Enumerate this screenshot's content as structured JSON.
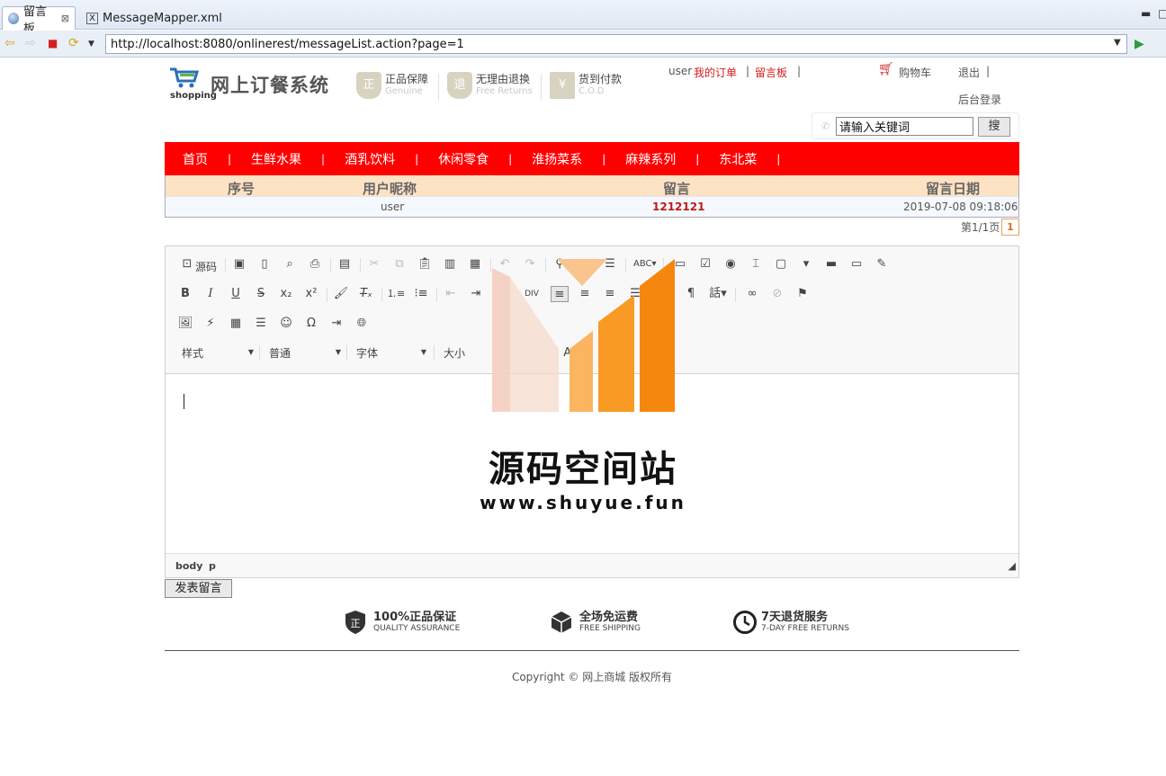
{
  "browser": {
    "tabs": [
      {
        "label": "留言板",
        "close": "⊠"
      },
      {
        "label": "MessageMapper.xml"
      }
    ],
    "url": "http://localhost:8080/onlinerest/messageList.action?page=1"
  },
  "header": {
    "logo_sub": "shopping",
    "site_title": "网上订餐系统",
    "guarantees": [
      {
        "icon": "正",
        "title": "正品保障",
        "sub": "Genuine"
      },
      {
        "icon": "退",
        "title": "无理由退换",
        "sub": "Free Returns"
      },
      {
        "icon": "¥",
        "title": "货到付款",
        "sub": "C.O.D"
      }
    ],
    "user": "user",
    "my_orders": "我的订单",
    "guestbook": "留言板",
    "divider": "|",
    "cart": "购物车",
    "logout": "退出",
    "admin_login": "后台登录",
    "search_placeholder": "请输入关键词",
    "search_button": "搜"
  },
  "nav": {
    "items": [
      "首页",
      "生鲜水果",
      "酒乳饮料",
      "休闲零食",
      "淮扬菜系",
      "麻辣系列",
      "东北菜"
    ],
    "divider": "|"
  },
  "message_table": {
    "columns": [
      "序号",
      "用户昵称",
      "留言",
      "留言日期"
    ],
    "rows": [
      {
        "id": "",
        "nickname": "user",
        "message": "1212121",
        "date": "2019-07-08 09:18:06"
      }
    ],
    "pager_text": "第1/1页",
    "current_page": "1"
  },
  "editor": {
    "source_label": "源码",
    "style_combo": "样式",
    "format_combo": "普通",
    "font_combo": "字体",
    "size_combo": "大小",
    "path": [
      "body",
      "p"
    ]
  },
  "post_button": "发表留言",
  "watermark": {
    "title": "源码空间站",
    "url": "www.shuyue.fun"
  },
  "footer": {
    "features": [
      {
        "title": "100%正品保证",
        "sub": "QUALITY ASSURANCE"
      },
      {
        "title": "全场免运费",
        "sub": "FREE SHIPPING"
      },
      {
        "title": "7天退货服务",
        "sub": "7-DAY FREE RETURNS"
      }
    ],
    "copyright": "Copyright © 网上商城 版权所有"
  },
  "colors": {
    "nav_red": "#ff0000",
    "link_red": "#d41b1b",
    "header_bg": "#fde2c4",
    "watermark_orange": "#f5870e"
  }
}
